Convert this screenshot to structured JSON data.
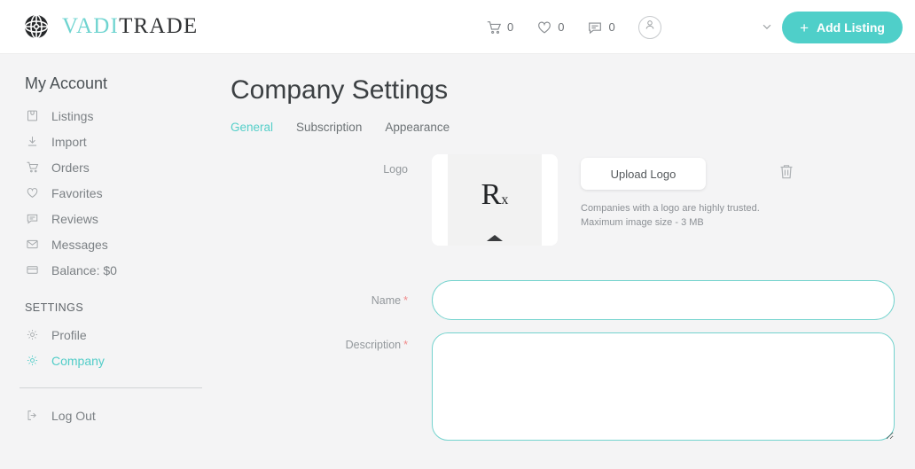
{
  "header": {
    "brand": {
      "part1": "VADI",
      "part2": "TRADE",
      "mark": "globe-icon"
    },
    "icons": [
      {
        "name": "cart-icon",
        "count": "0"
      },
      {
        "name": "heart-icon",
        "count": "0"
      },
      {
        "name": "message-icon",
        "count": "0"
      }
    ],
    "account": {
      "name": "user-avatar-icon"
    },
    "dropdown": {
      "name": "chevron-down-icon"
    },
    "add_listing": {
      "label": "Add Listing",
      "plus": "+"
    }
  },
  "sidebar": {
    "title": "My Account",
    "items": [
      {
        "label": "Listings",
        "icon": "listings-icon"
      },
      {
        "label": "Import",
        "icon": "import-icon"
      },
      {
        "label": "Orders",
        "icon": "cart-icon"
      },
      {
        "label": "Favorites",
        "icon": "heart-icon"
      },
      {
        "label": "Reviews",
        "icon": "review-icon"
      },
      {
        "label": "Messages",
        "icon": "envelope-icon"
      },
      {
        "label": "Balance: $0",
        "icon": "card-icon"
      }
    ],
    "section": "SETTINGS",
    "settings_items": [
      {
        "label": "Profile",
        "icon": "gear-icon",
        "active": false
      },
      {
        "label": "Company",
        "icon": "gear-icon",
        "active": true
      }
    ],
    "logout": {
      "label": "Log Out",
      "icon": "logout-icon"
    }
  },
  "main": {
    "title": "Company Settings",
    "tabs": [
      {
        "label": "General",
        "active": true
      },
      {
        "label": "Subscription",
        "active": false
      },
      {
        "label": "Appearance",
        "active": false
      }
    ],
    "logo_field": {
      "label": "Logo",
      "preview_glyph": "Rx",
      "upload_label": "Upload Logo",
      "help_line1": "Companies with a logo are highly trusted.",
      "help_line2": "Maximum image size - 3 MB",
      "delete_icon": "trash-icon"
    },
    "name_field": {
      "label": "Name",
      "required": "*",
      "value": "",
      "placeholder": ""
    },
    "description_field": {
      "label": "Description",
      "required": "*",
      "value": "",
      "placeholder": ""
    }
  },
  "colors": {
    "accent": "#4fcfc9",
    "background": "#f4f4f5",
    "required": "#f08a8a"
  }
}
